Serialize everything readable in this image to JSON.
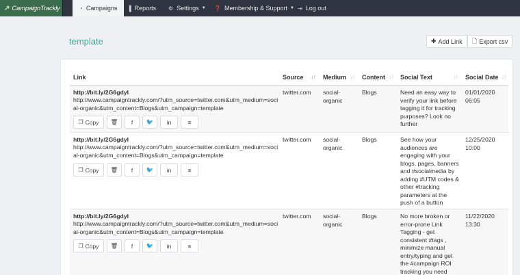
{
  "navbar": {
    "logo_text": "CampaignTrackly",
    "items": [
      {
        "label": "Campaigns",
        "icon": "tachometer-icon"
      },
      {
        "label": "Reports",
        "icon": "bar-chart-icon"
      },
      {
        "label": "Settings",
        "icon": "gears-icon"
      },
      {
        "label": "Membership & Support",
        "icon": "question-circle-icon"
      },
      {
        "label": "Log out",
        "icon": "sign-out-icon"
      }
    ]
  },
  "page": {
    "title": "template",
    "add_link_label": "Add Link",
    "export_label": "Export csv"
  },
  "table": {
    "columns": [
      "Link",
      "Source",
      "Medium",
      "Content",
      "Social Text",
      "Social Date"
    ],
    "copy_label": "Copy",
    "action_icons": [
      "trash-icon",
      "facebook-icon",
      "twitter-icon",
      "linkedin-icon",
      "buffer-icon"
    ],
    "rows": [
      {
        "short_link": "http://bit.ly/2G6gdyl",
        "long_link": "http://www.campaigntrackly.com/?utm_source=twitter.com&utm_medium=social-organic&utm_content=Blogs&utm_campaign=template",
        "source": "twitter.com",
        "medium": "social-organic",
        "content": "Blogs",
        "social_text": "Need an easy way to verify your link before tagging it for tracking purposes? Look no further",
        "social_date": "01/01/2020 06:05"
      },
      {
        "short_link": "http://bit.ly/2G6gdyl",
        "long_link": "http://www.campaigntrackly.com/?utm_source=twitter.com&utm_medium=social-organic&utm_content=Blogs&utm_campaign=template",
        "source": "twitter.com",
        "medium": "social-organic",
        "content": "Blogs",
        "social_text": "See how your audiences are engaging with your blogs, pages, banners and #socialmedia by adding #UTM codes & other #tracking parameters at the push of a button",
        "social_date": "12/25/2020 10:00"
      },
      {
        "short_link": "http://bit.ly/2G6gdyl",
        "long_link": "http://www.campaigntrackly.com/?utm_source=twitter.com&utm_medium=social-organic&utm_content=Blogs&utm_campaign=template",
        "source": "twitter.com",
        "medium": "social-organic",
        "content": "Blogs",
        "social_text": "No more broken or error-prone Link Tagging - get consistent #tags , minimize manual entry/typing and get the #campaign ROI tracking you need",
        "social_date": "11/22/2020 13:30"
      }
    ]
  }
}
